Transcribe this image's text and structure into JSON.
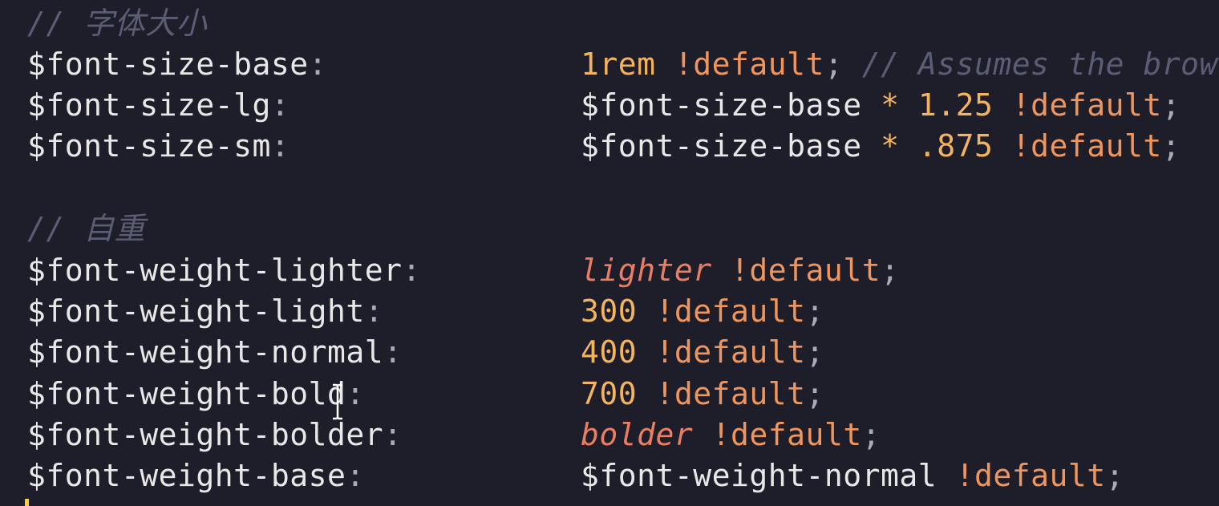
{
  "comments": {
    "font_size": "// 字体大小",
    "font_weight": "// 自重"
  },
  "lines": {
    "fs_base": {
      "var": "$font-size-base",
      "colon": ":",
      "num": "1rem",
      "kw": "!default",
      "semi": ";",
      "comment": "// Assumes the brows"
    },
    "fs_lg": {
      "var": "$font-size-lg",
      "colon": ":",
      "ref": "$font-size-base",
      "op": "*",
      "num": "1.25",
      "kw": "!default",
      "semi": ";"
    },
    "fs_sm": {
      "var": "$font-size-sm",
      "colon": ":",
      "ref": "$font-size-base",
      "op": "*",
      "num": ".875",
      "kw": "!default",
      "semi": ";"
    },
    "fw_lighter": {
      "var": "$font-weight-lighter",
      "colon": ":",
      "word": "lighter",
      "kw": "!default",
      "semi": ";"
    },
    "fw_light": {
      "var": "$font-weight-light",
      "colon": ":",
      "num": "300",
      "kw": "!default",
      "semi": ";"
    },
    "fw_normal": {
      "var": "$font-weight-normal",
      "colon": ":",
      "num": "400",
      "kw": "!default",
      "semi": ";"
    },
    "fw_bold": {
      "var": "$font-weight-bold",
      "colon": ":",
      "num": "700",
      "kw": "!default",
      "semi": ";"
    },
    "fw_bolder": {
      "var": "$font-weight-bolder",
      "colon": ":",
      "word": "bolder",
      "kw": "!default",
      "semi": ";"
    },
    "fw_base": {
      "var": "$font-weight-base",
      "colon": ":",
      "ref": "$font-weight-normal",
      "kw": "!default",
      "semi": ";"
    }
  },
  "colors": {
    "background": "#1e1e2b",
    "variable": "#e8e8e8",
    "number": "#f3b35f",
    "keyword": "#f0955c",
    "comment": "#5a5d73",
    "caret": "#ffcc33"
  }
}
